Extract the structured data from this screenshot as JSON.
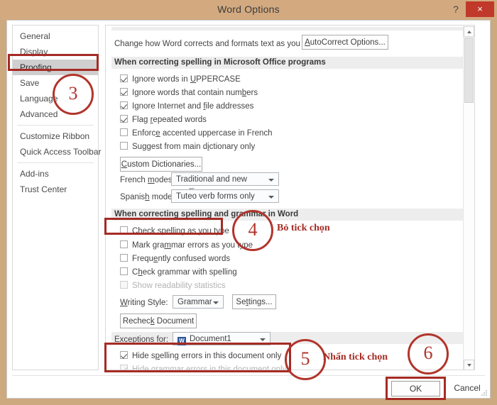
{
  "window": {
    "title": "Word Options",
    "help_icon": "?",
    "close_icon": "×"
  },
  "sidebar": {
    "items": [
      {
        "label": "General",
        "selected": false
      },
      {
        "label": "Display",
        "selected": false
      },
      {
        "label": "Proofing",
        "selected": true
      },
      {
        "label": "Save",
        "selected": false
      },
      {
        "label": "Language",
        "selected": false
      },
      {
        "label": "Advanced",
        "selected": false
      },
      {
        "label": "Customize Ribbon",
        "selected": false
      },
      {
        "label": "Quick Access Toolbar",
        "selected": false
      },
      {
        "label": "Add-ins",
        "selected": false
      },
      {
        "label": "Trust Center",
        "selected": false
      }
    ]
  },
  "content": {
    "autocorrect_label": "Change how Word corrects and formats text as you type:",
    "autocorrect_button": "AutoCorrect Options...",
    "section_office": "When correcting spelling in Microsoft Office programs",
    "office_checkboxes": [
      {
        "label": "Ignore words in UPPERCASE",
        "checked": true,
        "disabled": false
      },
      {
        "label": "Ignore words that contain numbers",
        "checked": true,
        "disabled": false
      },
      {
        "label": "Ignore Internet and file addresses",
        "checked": true,
        "disabled": false
      },
      {
        "label": "Flag repeated words",
        "checked": true,
        "disabled": false
      },
      {
        "label": "Enforce accented uppercase in French",
        "checked": false,
        "disabled": false
      },
      {
        "label": "Suggest from main dictionary only",
        "checked": false,
        "disabled": false
      }
    ],
    "custom_dictionaries_button": "Custom Dictionaries...",
    "french_modes_label": "French modes:",
    "french_modes_value": "Traditional and new spellings",
    "spanish_modes_label": "Spanish modes:",
    "spanish_modes_value": "Tuteo verb forms only",
    "section_word": "When correcting spelling and grammar in Word",
    "word_checkboxes": [
      {
        "label": "Check spelling as you type",
        "checked": false,
        "disabled": false
      },
      {
        "label": "Mark grammar errors as you type",
        "checked": false,
        "disabled": false
      },
      {
        "label": "Frequently confused words",
        "checked": false,
        "disabled": false
      },
      {
        "label": "Check grammar with spelling",
        "checked": false,
        "disabled": false
      },
      {
        "label": "Show readability statistics",
        "checked": false,
        "disabled": true
      }
    ],
    "writing_style_label": "Writing Style:",
    "writing_style_value": "Grammar",
    "settings_button": "Settings...",
    "recheck_button": "Recheck Document",
    "exceptions_label": "Exceptions for:",
    "exceptions_value": "Document1",
    "exceptions_icon": "W",
    "exception_checkboxes": [
      {
        "label": "Hide spelling errors in this document only",
        "checked": true,
        "disabled": false
      },
      {
        "label": "Hide grammar errors in this document only",
        "checked": true,
        "disabled": true
      }
    ]
  },
  "footer": {
    "ok_label": "OK",
    "cancel_label": "Cancel"
  },
  "annotations": {
    "step3": "3",
    "step4": "4",
    "step4_text": "Bỏ tick chọn",
    "step5": "5",
    "step5_text": "Nhấn tick chọn",
    "step6": "6"
  },
  "colors": {
    "titlebar": "#d3aa80",
    "close": "#c0392b",
    "annotation_red": "#a52b24",
    "selected_nav": "#cfcfcf",
    "section_header": "#ededed"
  }
}
